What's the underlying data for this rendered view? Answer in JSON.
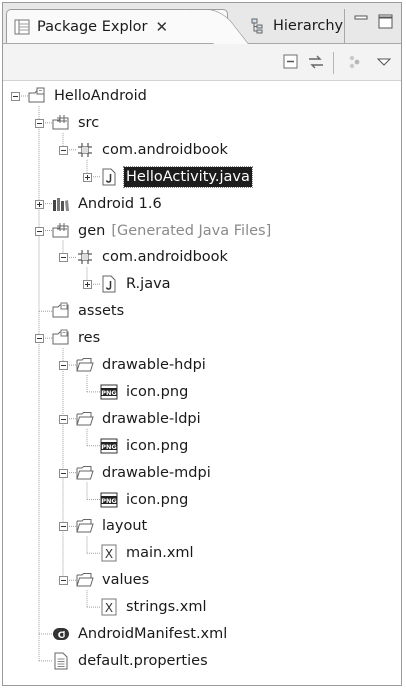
{
  "tabs": [
    {
      "label": "Package Explor",
      "close": "✕",
      "active": true
    },
    {
      "label": "Hierarchy",
      "active": false
    }
  ],
  "window_controls": {
    "minimize": "minimize-icon",
    "maximize": "maximize-icon"
  },
  "toolbar": [
    "collapse-all-icon",
    "link-with-editor-icon",
    "view-filter-icon",
    "view-menu-icon"
  ],
  "tree": [
    {
      "label": "HelloAndroid",
      "icon": "android-project-icon",
      "depth": 0,
      "toggle": "minus"
    },
    {
      "label": "src",
      "icon": "source-folder-icon",
      "depth": 1,
      "toggle": "minus"
    },
    {
      "label": "com.androidbook",
      "icon": "package-icon",
      "depth": 2,
      "toggle": "minus"
    },
    {
      "label": "HelloActivity.java",
      "icon": "java-file-icon",
      "depth": 3,
      "toggle": "plus",
      "selected": true
    },
    {
      "label": "Android 1.6",
      "icon": "library-icon",
      "depth": 1,
      "toggle": "plus"
    },
    {
      "label": "gen",
      "decoration": "[Generated Java Files]",
      "icon": "source-folder-icon",
      "depth": 1,
      "toggle": "minus"
    },
    {
      "label": "com.androidbook",
      "icon": "package-icon",
      "depth": 2,
      "toggle": "minus"
    },
    {
      "label": "R.java",
      "icon": "java-file-icon",
      "depth": 3,
      "toggle": "plus"
    },
    {
      "label": "assets",
      "icon": "folder-icon",
      "depth": 1,
      "toggle": null
    },
    {
      "label": "res",
      "icon": "folder-icon",
      "depth": 1,
      "toggle": "minus"
    },
    {
      "label": "drawable-hdpi",
      "icon": "open-folder-icon",
      "depth": 2,
      "toggle": "minus"
    },
    {
      "label": "icon.png",
      "icon": "png-file-icon",
      "depth": 3,
      "toggle": null
    },
    {
      "label": "drawable-ldpi",
      "icon": "open-folder-icon",
      "depth": 2,
      "toggle": "minus"
    },
    {
      "label": "icon.png",
      "icon": "png-file-icon",
      "depth": 3,
      "toggle": null
    },
    {
      "label": "drawable-mdpi",
      "icon": "open-folder-icon",
      "depth": 2,
      "toggle": "minus"
    },
    {
      "label": "icon.png",
      "icon": "png-file-icon",
      "depth": 3,
      "toggle": null
    },
    {
      "label": "layout",
      "icon": "open-folder-icon",
      "depth": 2,
      "toggle": "minus"
    },
    {
      "label": "main.xml",
      "icon": "xml-file-icon",
      "depth": 3,
      "toggle": null
    },
    {
      "label": "values",
      "icon": "open-folder-icon",
      "depth": 2,
      "toggle": "minus"
    },
    {
      "label": "strings.xml",
      "icon": "xml-file-icon",
      "depth": 3,
      "toggle": null
    },
    {
      "label": "AndroidManifest.xml",
      "icon": "manifest-file-icon",
      "depth": 1,
      "toggle": null
    },
    {
      "label": "default.properties",
      "icon": "properties-file-icon",
      "depth": 1,
      "toggle": null
    }
  ],
  "colors": {
    "selection": "#1c1c1c",
    "decoration": "#8a8a8a",
    "frame": "#9a9a9a"
  }
}
